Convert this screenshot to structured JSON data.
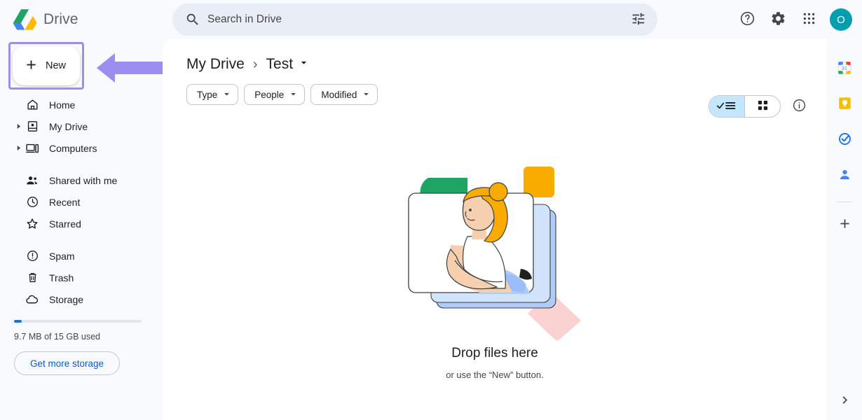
{
  "app": {
    "brand_name": "Drive",
    "logo_icon": "drive-logo"
  },
  "search": {
    "placeholder": "Search in Drive",
    "value": "",
    "search_icon": "search-icon",
    "tune_icon": "tune-icon"
  },
  "header": {
    "help_icon": "help-circle-icon",
    "settings_icon": "gear-icon",
    "apps_icon": "apps-grid-icon",
    "avatar_letter": "O",
    "avatar_color": "#009faf"
  },
  "sidebar": {
    "new_button": {
      "label": "New",
      "plus_icon": "plus-icon"
    },
    "annotation": {
      "arrow_icon": "left-arrow-annotation",
      "arrow_color": "#9a8ff0",
      "highlight_color": "#9a8ff0"
    },
    "groups": [
      {
        "items": [
          {
            "label": "Home",
            "icon": "home-icon",
            "expandable": false
          },
          {
            "label": "My Drive",
            "icon": "my-drive-icon",
            "expandable": true
          },
          {
            "label": "Computers",
            "icon": "computers-icon",
            "expandable": true
          }
        ]
      },
      {
        "items": [
          {
            "label": "Shared with me",
            "icon": "shared-people-icon",
            "expandable": false
          },
          {
            "label": "Recent",
            "icon": "clock-icon",
            "expandable": false
          },
          {
            "label": "Starred",
            "icon": "star-icon",
            "expandable": false
          }
        ]
      },
      {
        "items": [
          {
            "label": "Spam",
            "icon": "spam-exclamation-icon",
            "expandable": false
          },
          {
            "label": "Trash",
            "icon": "trash-icon",
            "expandable": false
          },
          {
            "label": "Storage",
            "icon": "cloud-icon",
            "expandable": false
          }
        ]
      }
    ],
    "storage": {
      "used_text": "9.7 MB of 15 GB used",
      "percent_used": 0.06,
      "button_label": "Get more storage",
      "button_color": "#0b57d0"
    }
  },
  "main": {
    "breadcrumb": {
      "root": "My Drive",
      "separator": "›",
      "current": "Test",
      "caret_icon": "chevron-down-icon"
    },
    "filters": [
      {
        "label": "Type",
        "caret_icon": "chevron-down-icon"
      },
      {
        "label": "People",
        "caret_icon": "chevron-down-icon"
      },
      {
        "label": "Modified",
        "caret_icon": "chevron-down-icon"
      }
    ],
    "view_toggle": {
      "list_icon": "list-view-check-icon",
      "grid_icon": "grid-view-icon",
      "active": "list",
      "active_color": "#c2e7ff"
    },
    "info_icon": "info-circle-icon",
    "empty_state": {
      "illustration": "person-sitting-with-files-illustration",
      "title": "Drop files here",
      "subtitle": "or use the “New” button."
    }
  },
  "rail": {
    "apps": [
      {
        "name": "calendar-icon",
        "label": "31"
      },
      {
        "name": "keep-icon",
        "label": ""
      },
      {
        "name": "tasks-icon",
        "label": ""
      },
      {
        "name": "contacts-icon",
        "label": ""
      }
    ],
    "add_icon": "plus-icon",
    "expand_icon": "chevron-right-icon"
  }
}
